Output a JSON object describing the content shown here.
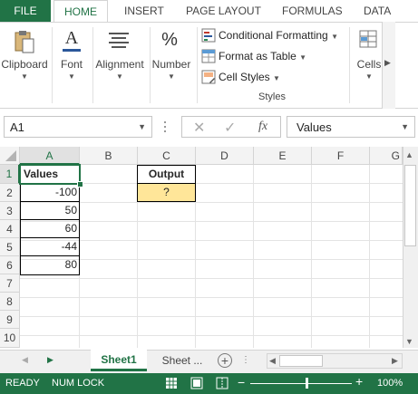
{
  "ribbon_tabs": [
    "FILE",
    "HOME",
    "INSERT",
    "PAGE LAYOUT",
    "FORMULAS",
    "DATA"
  ],
  "ribbon": {
    "clipboard": "Clipboard",
    "font": "Font",
    "alignment": "Alignment",
    "number": "Number",
    "conditional_formatting": "Conditional Formatting",
    "format_as_table": "Format as Table",
    "cell_styles": "Cell Styles",
    "styles_group": "Styles",
    "cells": "Cells",
    "number_icon": "%",
    "font_icon": "A"
  },
  "formula_bar": {
    "name_box": "A1",
    "fx": "fx",
    "value": "Values"
  },
  "grid": {
    "columns": [
      "A",
      "B",
      "C",
      "D",
      "E",
      "F",
      "G"
    ],
    "rows": [
      "1",
      "2",
      "3",
      "4",
      "5",
      "6",
      "7",
      "8",
      "9",
      "10"
    ],
    "a1": "Values",
    "a2": "-100",
    "a3": "50",
    "a4": "60",
    "a5": "-44",
    "a6": "80",
    "c1": "Output",
    "c2": "?"
  },
  "sheets": [
    "Sheet1",
    "Sheet ..."
  ],
  "status_bar": {
    "ready": "READY",
    "num_lock": "NUM LOCK",
    "zoom": "100%"
  },
  "colors": {
    "accent": "#217346",
    "output_fill": "#ffe699"
  }
}
